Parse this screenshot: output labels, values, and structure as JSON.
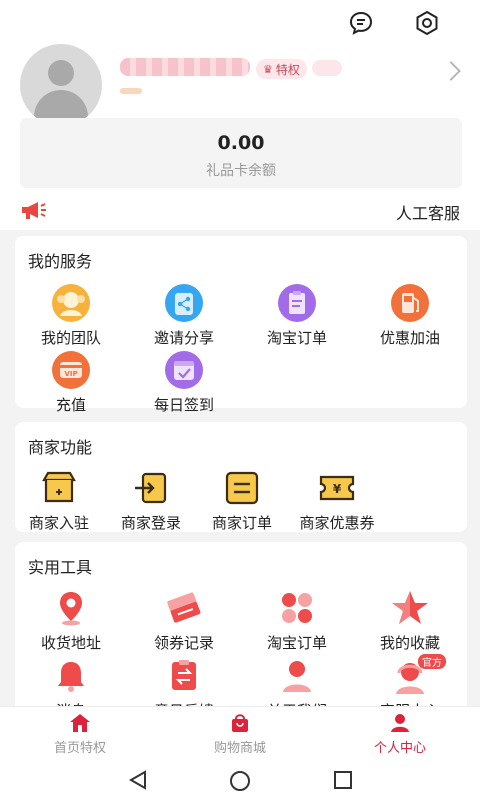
{
  "header": {
    "badge_label": "特权"
  },
  "balance": {
    "value": "0.00",
    "label": "礼品卡余额"
  },
  "notice": {
    "text": "人工客服"
  },
  "services": {
    "title": "我的服务",
    "items": [
      {
        "label": "我的团队",
        "icon": "team-icon",
        "color": "#f6b23c"
      },
      {
        "label": "邀请分享",
        "icon": "share-icon",
        "color": "#35a6f0"
      },
      {
        "label": "淘宝订单",
        "icon": "order-icon",
        "color": "#a26ce8"
      },
      {
        "label": "优惠加油",
        "icon": "fuel-icon",
        "color": "#f2703a"
      },
      {
        "label": "充值",
        "icon": "vip-recharge-icon",
        "color": "#f2703a"
      },
      {
        "label": "每日签到",
        "icon": "calendar-checkin-icon",
        "color": "#a26ce8"
      }
    ]
  },
  "merchant": {
    "title": "商家功能",
    "items": [
      {
        "label": "商家入驻",
        "icon": "store-icon"
      },
      {
        "label": "商家登录",
        "icon": "login-icon"
      },
      {
        "label": "商家订单",
        "icon": "merchant-order-icon"
      },
      {
        "label": "商家优惠券",
        "icon": "coupon-icon"
      }
    ],
    "icon_color": "#3d2b13",
    "icon_fill": "#f6c84c"
  },
  "tools": {
    "title": "实用工具",
    "items": [
      {
        "label": "收货地址",
        "icon": "location-icon"
      },
      {
        "label": "领券记录",
        "icon": "ticket-icon"
      },
      {
        "label": "淘宝订单",
        "icon": "grid-icon"
      },
      {
        "label": "我的收藏",
        "icon": "star-icon"
      },
      {
        "label": "消息",
        "icon": "bell-icon"
      },
      {
        "label": "意见反馈",
        "icon": "feedback-icon"
      },
      {
        "label": "关于我们",
        "icon": "person-icon"
      },
      {
        "label": "客服中心",
        "icon": "headset-icon",
        "tag": "官方"
      }
    ],
    "icon_color": "#ee4b4b"
  },
  "bottom_nav": {
    "items": [
      {
        "label": "首页特权",
        "icon": "home-icon"
      },
      {
        "label": "购物商城",
        "icon": "shopping-bag-icon"
      },
      {
        "label": "个人中心",
        "icon": "profile-icon",
        "active": true
      }
    ],
    "active_color": "#d9243c"
  },
  "colors": {
    "accent": "#d9243c",
    "background": "#f3f3f3"
  }
}
